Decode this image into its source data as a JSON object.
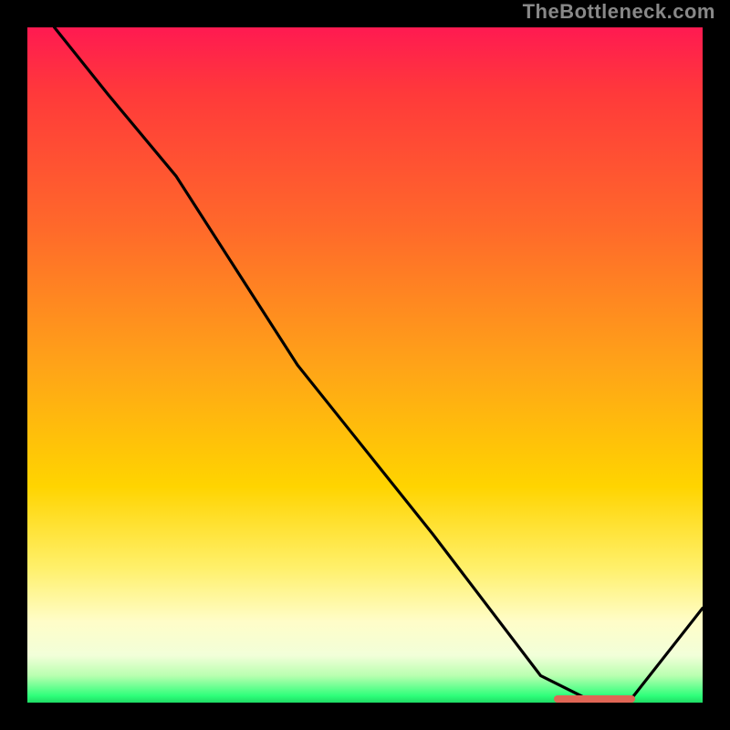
{
  "watermark": "TheBottleneck.com",
  "chart_data": {
    "type": "line",
    "title": "",
    "xlabel": "",
    "ylabel": "",
    "xlim": [
      0,
      100
    ],
    "ylim": [
      0,
      100
    ],
    "grid": false,
    "series": [
      {
        "name": "curve",
        "x": [
          4,
          12,
          22,
          40,
          60,
          76,
          84,
          89,
          100
        ],
        "y": [
          100,
          90,
          78,
          50,
          25,
          4,
          0,
          0,
          14
        ]
      }
    ],
    "marker": {
      "x_start": 78,
      "x_end": 90,
      "y": 0.5
    },
    "gradient_stops": [
      {
        "pct": 0,
        "color": "#ff1a51"
      },
      {
        "pct": 10,
        "color": "#ff3a3a"
      },
      {
        "pct": 30,
        "color": "#ff6a2a"
      },
      {
        "pct": 50,
        "color": "#ffa318"
      },
      {
        "pct": 68,
        "color": "#ffd400"
      },
      {
        "pct": 80,
        "color": "#fff06a"
      },
      {
        "pct": 88,
        "color": "#fffdc8"
      },
      {
        "pct": 93,
        "color": "#f2ffd9"
      },
      {
        "pct": 96,
        "color": "#b9ffb0"
      },
      {
        "pct": 99,
        "color": "#2eff7a"
      },
      {
        "pct": 100,
        "color": "#1edb64"
      }
    ]
  }
}
